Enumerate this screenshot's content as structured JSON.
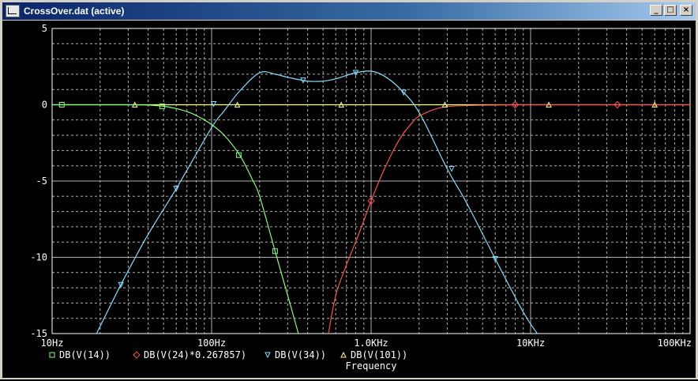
{
  "window": {
    "title": "CrossOver.dat (active)",
    "buttons": {
      "minimize": "_",
      "maximize": "□",
      "close": "×"
    }
  },
  "colors": {
    "background": "#000000",
    "grid": "#b0b0b0",
    "axis_text": "#ffffff",
    "series_v14": "#80ff80",
    "series_v24": "#ff5050",
    "series_v34": "#80e0ff",
    "series_v101": "#ffff80"
  },
  "chart_data": {
    "type": "line",
    "xscale": "log",
    "xlim": [
      10,
      100000
    ],
    "ylim": [
      -15,
      5
    ],
    "xlabel": "Frequency",
    "ylabel": "",
    "grid": true,
    "x_tick_labels": [
      {
        "value": 10,
        "label": "10Hz"
      },
      {
        "value": 100,
        "label": "100Hz"
      },
      {
        "value": 1000,
        "label": "1.0KHz"
      },
      {
        "value": 10000,
        "label": "10KHz"
      },
      {
        "value": 100000,
        "label": "100KHz"
      }
    ],
    "y_tick_labels": [
      {
        "value": 5,
        "label": "5"
      },
      {
        "value": 0,
        "label": "0"
      },
      {
        "value": -5,
        "label": "-5"
      },
      {
        "value": -10,
        "label": "-10"
      },
      {
        "value": -15,
        "label": "-15"
      }
    ],
    "series": [
      {
        "name": "DB(V(14))",
        "color": "#80ff80",
        "marker": "square",
        "x": [
          10,
          20,
          30,
          40,
          50,
          60,
          70,
          80,
          100,
          120,
          150,
          180,
          200,
          250,
          300,
          350
        ],
        "y": [
          0,
          0,
          0,
          -0.02,
          -0.1,
          -0.25,
          -0.45,
          -0.7,
          -1.3,
          -2.0,
          -3.3,
          -4.9,
          -6.0,
          -9.6,
          -12.5,
          -15
        ]
      },
      {
        "name": "DB(V(24)*0.267857)",
        "color": "#ff5050",
        "marker": "diamond",
        "x": [
          540,
          600,
          700,
          800,
          900,
          1000,
          1200,
          1500,
          1800,
          2000,
          2500,
          3000,
          4000,
          6000,
          8000,
          10000,
          20000,
          35000,
          60000,
          100000
        ],
        "y": [
          -15,
          -12.5,
          -10.5,
          -9.0,
          -7.6,
          -6.3,
          -4.3,
          -2.3,
          -1.2,
          -0.75,
          -0.3,
          -0.12,
          -0.05,
          -0.02,
          0,
          0,
          0,
          0,
          0,
          0
        ]
      },
      {
        "name": "DB(V(34))",
        "color": "#80e0ff",
        "marker": "triangle-down",
        "x": [
          19,
          27,
          40,
          60,
          100,
          120,
          150,
          200,
          250,
          300,
          400,
          500,
          600,
          800,
          1000,
          1200,
          1500,
          2000,
          3000,
          4000,
          6000,
          9000,
          11000
        ],
        "y": [
          -15,
          -11.8,
          -8.5,
          -5.5,
          -1.5,
          -0.4,
          0.9,
          2.1,
          2.0,
          1.8,
          1.55,
          1.55,
          1.7,
          2.1,
          2.2,
          1.9,
          1.1,
          -0.5,
          -4.2,
          -6.5,
          -10.1,
          -13.6,
          -15
        ]
      },
      {
        "name": "DB(V(101))",
        "color": "#ffff80",
        "marker": "triangle-up",
        "x": [
          10,
          100000
        ],
        "y": [
          0,
          0
        ]
      }
    ],
    "marker_points": {
      "DB(V(14))": [
        [
          11.5,
          0
        ],
        [
          49,
          -0.1
        ],
        [
          148,
          -3.3
        ],
        [
          250,
          -9.6
        ]
      ],
      "DB(V(24)*0.267857)": [
        [
          1000,
          -6.3
        ],
        [
          8000,
          0
        ],
        [
          35000,
          0
        ]
      ],
      "DB(V(34))": [
        [
          27,
          -11.8
        ],
        [
          60,
          -5.5
        ],
        [
          103,
          0.05
        ],
        [
          375,
          1.6
        ],
        [
          800,
          2.1
        ],
        [
          1600,
          0.8
        ],
        [
          3200,
          -4.2
        ],
        [
          6000,
          -10.1
        ]
      ],
      "DB(V(101))": [
        [
          33,
          0
        ],
        [
          145,
          0
        ],
        [
          650,
          0
        ],
        [
          2900,
          0
        ],
        [
          13000,
          0
        ],
        [
          60000,
          0
        ]
      ]
    }
  }
}
